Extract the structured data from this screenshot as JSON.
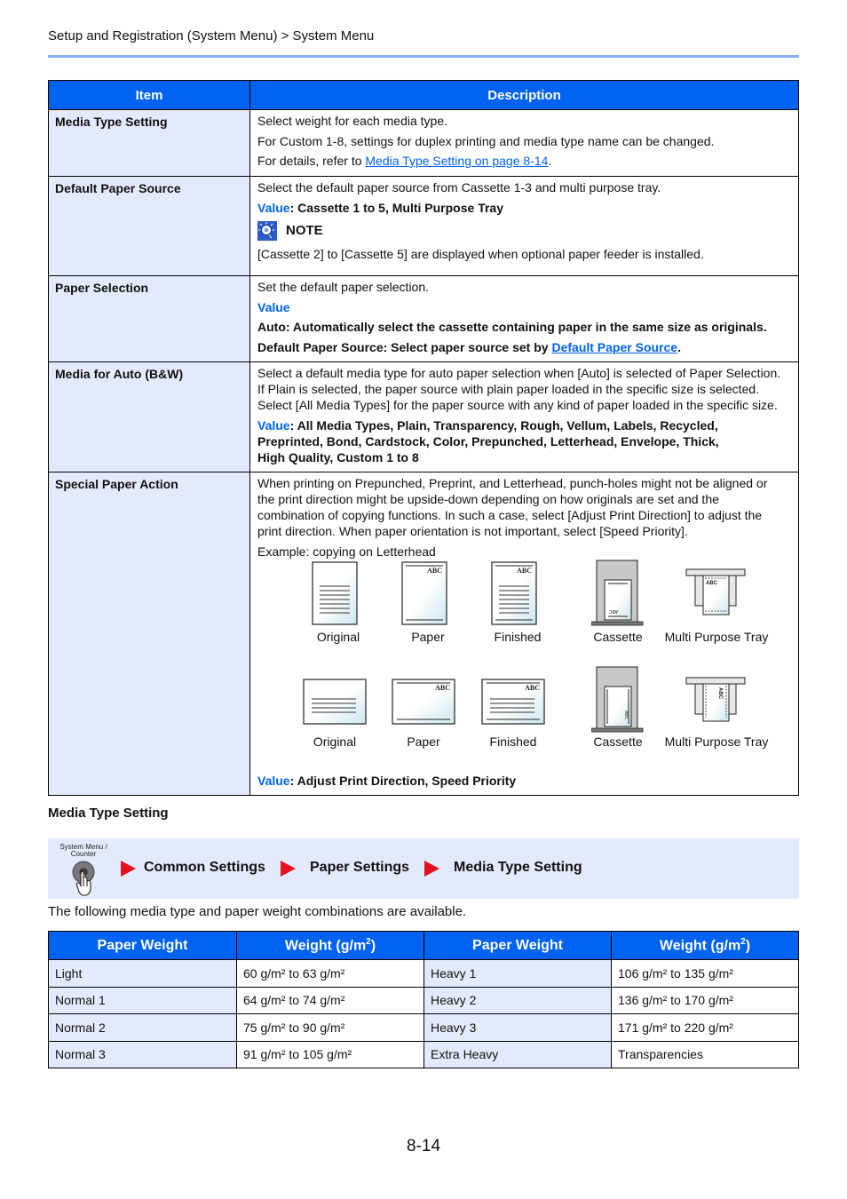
{
  "header": {
    "breadcrumb": "Setup and Registration (System Menu) > System Menu"
  },
  "main_table": {
    "columns": [
      "Item",
      "Description"
    ],
    "rows": [
      {
        "item": "Media Type Setting",
        "lines": [
          "Select weight for each media type.",
          "For Custom 1-8, settings for duplex printing and media type name can be changed."
        ],
        "ref_prefix": "For details, refer to ",
        "ref_link": "Media Type Setting on page 8-14",
        "ref_suffix": "."
      },
      {
        "item": "Default Paper Source",
        "line": "Select the default paper source from Cassette 1-3 and multi purpose tray.",
        "value_label": "Value",
        "value_text": ": Cassette 1 to 5, Multi Purpose Tray",
        "note_label": "NOTE",
        "note_text": "[Cassette 2] to [Cassette 5] are displayed when optional paper feeder is installed."
      },
      {
        "item": "Paper Selection",
        "line": "Set the default paper selection.",
        "value_label": "Value",
        "option_auto": "Auto: Automatically select the cassette containing paper in the same size as originals.",
        "option_default_prefix": "Default Paper Source: Select paper source set by ",
        "option_default_link": "Default Paper Source",
        "option_default_suffix": "."
      },
      {
        "item": "Media for Auto (B&W)",
        "lines": [
          "Select a default media type for auto paper selection when [Auto] is selected of Paper Selection.",
          "If Plain is selected, the paper source with plain paper loaded in the specific size is selected.",
          "Select [All Media Types] for the paper source with any kind of paper loaded in the specific size."
        ],
        "value_label": "Value",
        "value_lines": [
          ": All Media Types, Plain, Transparency, Rough, Vellum, Labels, Recycled,",
          "Preprinted, Bond, Cardstock, Color, Prepunched, Letterhead, Envelope, Thick,",
          "High Quality, Custom 1 to 8"
        ]
      },
      {
        "item": "Special Paper Action",
        "lines": [
          "When printing on Prepunched, Preprint, and Letterhead, punch-holes might not be aligned or",
          "the print direction might be upside-down depending on how originals are set and the",
          "combination of copying functions. In such a case, select [Adjust Print Direction] to adjust the",
          "print direction. When paper orientation is not important, select [Speed Priority]."
        ],
        "example": "Example: copying on Letterhead",
        "figures_row1": [
          "Original",
          "Paper",
          "Finished",
          "Cassette",
          "Multi Purpose Tray"
        ],
        "figures_row2": [
          "Original",
          "Paper",
          "Finished",
          "Cassette",
          "Multi Purpose Tray"
        ],
        "figure_print_text": "ABC",
        "value_label": "Value",
        "value_text": ": Adjust Print Direction, Speed Priority"
      }
    ]
  },
  "section": {
    "title": "Media Type Setting",
    "nav_button_label_1": "System Menu /",
    "nav_button_label_2": "Counter",
    "nav_steps": [
      "Common Settings",
      "Paper Settings",
      "Media Type Setting"
    ],
    "intro": "The following media type and paper weight combinations are available."
  },
  "weight_table": {
    "col_paper_weight": "Paper Weight",
    "col_weight": "Weight (g/m",
    "col_weight_sup": "2",
    "col_weight_close": ")",
    "rows": [
      {
        "a_name": "Light",
        "a_weight": "60 g/m² to 63 g/m²",
        "b_name": "Heavy 1",
        "b_weight": "106 g/m² to 135 g/m²"
      },
      {
        "a_name": "Normal 1",
        "a_weight": "64 g/m² to 74 g/m²",
        "b_name": "Heavy 2",
        "b_weight": "136 g/m² to 170 g/m²"
      },
      {
        "a_name": "Normal 2",
        "a_weight": "75 g/m² to 90 g/m²",
        "b_name": "Heavy 3",
        "b_weight": "171 g/m² to 220 g/m²"
      },
      {
        "a_name": "Normal 3",
        "a_weight": "91 g/m² to 105 g/m²",
        "b_name": "Extra Heavy",
        "b_weight": "Transparencies"
      }
    ]
  },
  "colors": {
    "header_blue": "#0062f0",
    "row_tint": "#e3eafb",
    "rule_blue": "#86acf3",
    "arrow_red": "#e6101e"
  },
  "footer": {
    "page_number": "8-14"
  }
}
